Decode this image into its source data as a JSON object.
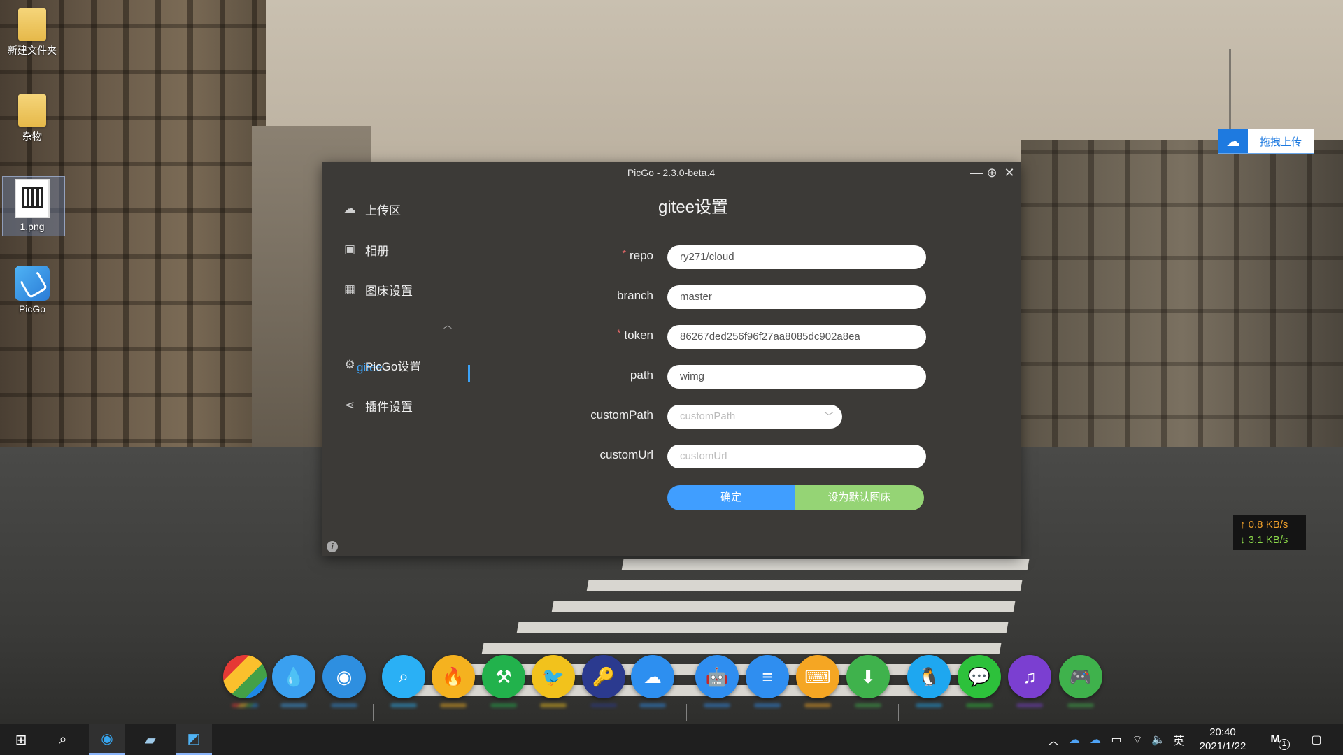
{
  "desktop": {
    "icons": [
      {
        "label": "新建文件夹"
      },
      {
        "label": "杂物"
      },
      {
        "label": "1.png"
      },
      {
        "label": "PicGo"
      }
    ],
    "drag_upload_label": "拖拽上传",
    "speed": {
      "up": "0.8 KB/s",
      "down": "3.1 KB/s"
    }
  },
  "window": {
    "title": "PicGo - 2.3.0-beta.4",
    "controls": {
      "minimize": "—",
      "maximize": "⊕",
      "close": "✕"
    }
  },
  "sidebar": {
    "items": [
      {
        "label": "上传区",
        "icon": "cloud-upload-icon"
      },
      {
        "label": "相册",
        "icon": "picture-icon"
      },
      {
        "label": "图床设置",
        "icon": "grid-icon"
      },
      {
        "label": "PicGo设置",
        "icon": "gear-icon"
      },
      {
        "label": "插件设置",
        "icon": "share-icon"
      }
    ],
    "sub_item": "gitee",
    "info": "i"
  },
  "form": {
    "title": "gitee设置",
    "fields": [
      {
        "label": "repo",
        "required": true,
        "value": "ry271/cloud"
      },
      {
        "label": "branch",
        "required": false,
        "value": "master"
      },
      {
        "label": "token",
        "required": true,
        "value": "86267ded256f96f27aa8085dc902a8ea"
      },
      {
        "label": "path",
        "required": false,
        "value": "wimg"
      },
      {
        "label": "customPath",
        "required": false,
        "placeholder": "customPath"
      },
      {
        "label": "customUrl",
        "required": false,
        "placeholder": "customUrl"
      }
    ],
    "confirm_label": "确定",
    "default_label": "设为默认图床"
  },
  "dock": [
    {
      "name": "multicolor-app",
      "color": "#1e88e5"
    },
    {
      "name": "drop-app",
      "color": "#3aa0f0"
    },
    {
      "name": "edge-app",
      "color": "#2e8fe0"
    },
    {
      "name": "search-app",
      "color": "#2ab0f5"
    },
    {
      "name": "fire-app",
      "color": "#f5b21f"
    },
    {
      "name": "hammer-app",
      "color": "#22b24c"
    },
    {
      "name": "bird-app",
      "color": "#f2c21c"
    },
    {
      "name": "key-app",
      "color": "#2b3a8f"
    },
    {
      "name": "cloud-app",
      "color": "#2d8ff0"
    },
    {
      "name": "android-app",
      "color": "#2f8ef0"
    },
    {
      "name": "notes-app",
      "color": "#2f8ef0"
    },
    {
      "name": "keyboard-app",
      "color": "#f5a623"
    },
    {
      "name": "download-app",
      "color": "#3fb24c"
    },
    {
      "name": "qq-app",
      "color": "#1ea7f0"
    },
    {
      "name": "wechat-app",
      "color": "#2dc13b"
    },
    {
      "name": "music-app",
      "color": "#7b3fd1"
    },
    {
      "name": "game-app",
      "color": "#3fb24c"
    }
  ],
  "taskbar": {
    "ime": "英",
    "time": "20:40",
    "date": "2021/1/22",
    "notify_count": "1"
  }
}
